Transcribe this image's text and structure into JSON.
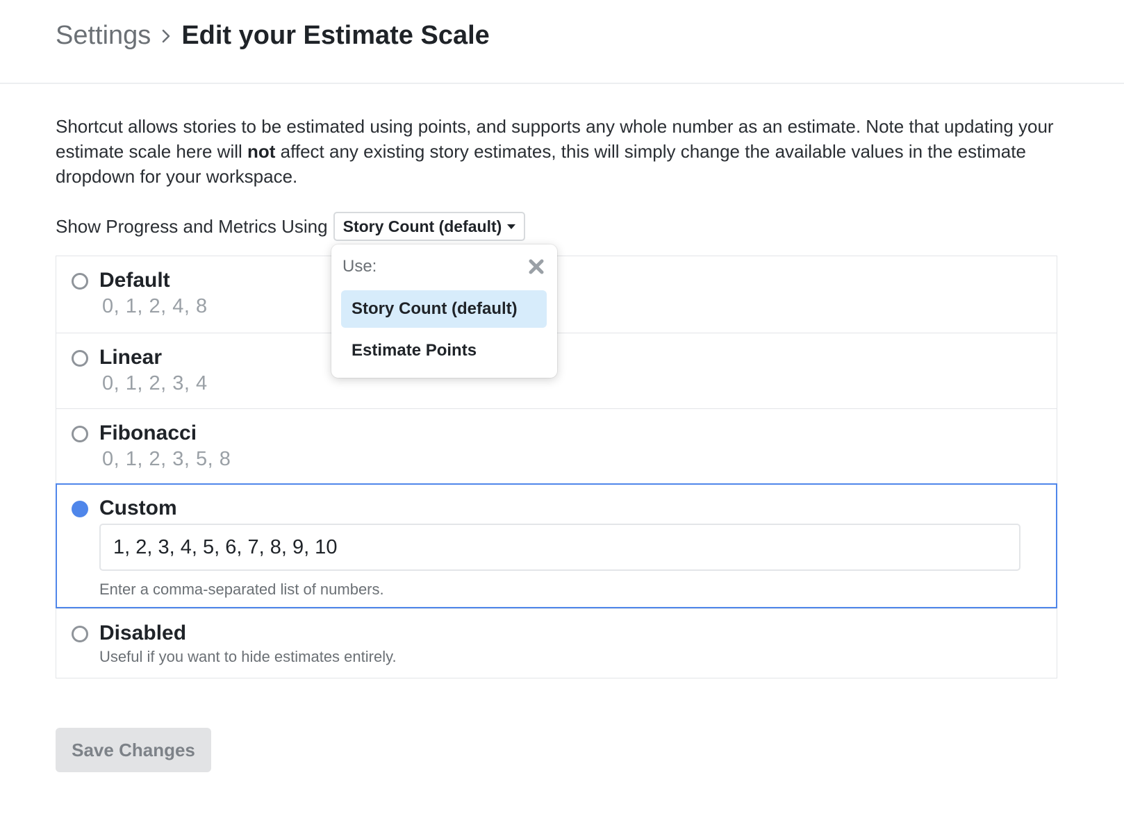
{
  "breadcrumb": {
    "parent": "Settings",
    "current": "Edit your Estimate Scale"
  },
  "intro": {
    "part1": "Shortcut allows stories to be estimated using points, and supports any whole number as an estimate. Note that updating your estimate scale here will ",
    "bold": "not",
    "part2": " affect any existing story estimates, this will simply change the available values in the estimate dropdown for your workspace."
  },
  "metrics": {
    "label": "Show Progress and Metrics Using",
    "selected": "Story Count (default)"
  },
  "dropdown": {
    "header": "Use:",
    "options": [
      "Story Count (default)",
      "Estimate Points"
    ],
    "highlighted": "Story Count (default)"
  },
  "scales": [
    {
      "title": "Default",
      "values": "0, 1, 2, 4, 8",
      "selected": false
    },
    {
      "title": "Linear",
      "values": "0, 1, 2, 3, 4",
      "selected": false
    },
    {
      "title": "Fibonacci",
      "values": "0, 1, 2, 3, 5, 8",
      "selected": false
    },
    {
      "title": "Custom",
      "input_value": "1, 2, 3, 4, 5, 6, 7, 8, 9, 10",
      "hint": "Enter a comma-separated list of numbers.",
      "selected": true
    },
    {
      "title": "Disabled",
      "hint": "Useful if you want to hide estimates entirely.",
      "selected": false
    }
  ],
  "save_button": "Save Changes",
  "colors": {
    "accent": "#4f86ea",
    "highlight": "#d7ecfb",
    "button_disabled_bg": "#e2e3e5"
  },
  "icons": {
    "breadcrumb_separator": "chevron-right-icon",
    "select_caret": "caret-down-icon",
    "dropdown_close": "close-icon"
  }
}
